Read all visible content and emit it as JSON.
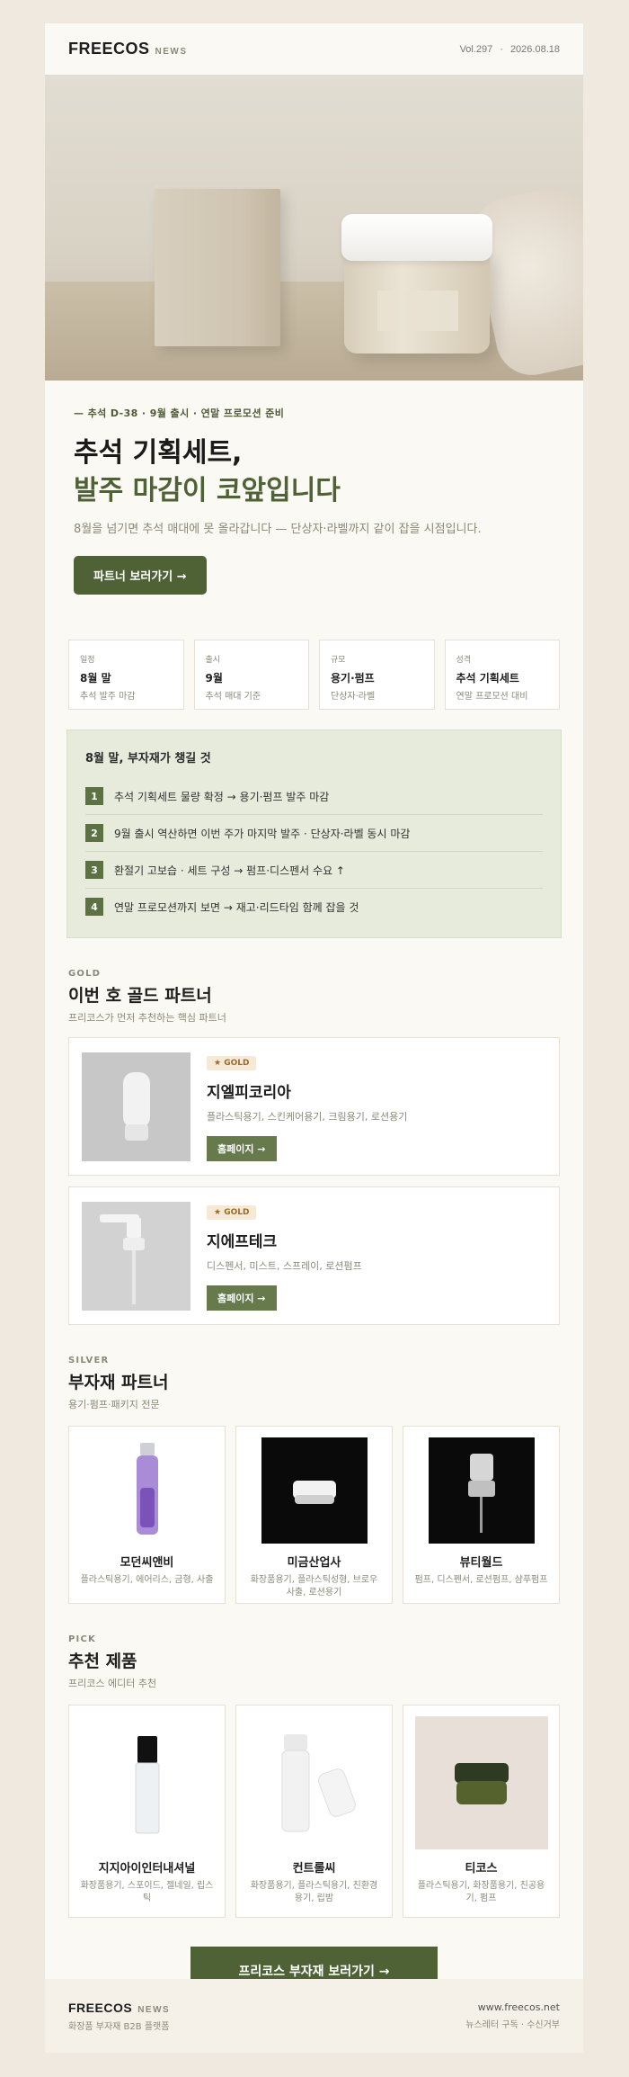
{
  "header": {
    "brand": "FREECOS",
    "brand_sub": "NEWS",
    "volume": "Vol.297",
    "dot": "·",
    "date": "2026.08.18"
  },
  "intro": {
    "tagline": "— 추석 D-38 · 9월 출시 · 연말 프로모션 준비",
    "title_line1": "추석 기획세트,",
    "title_line2": "발주 마감이 코앞입니다",
    "desc": "8월을 넘기면 추석 매대에 못 올라갑니다 — 단상자·라벨까지 같이 잡을 시점입니다.",
    "cta": "파트너 보러가기 →"
  },
  "stats": [
    {
      "key": "일정",
      "value": "8월 말",
      "sub": "추석 발주 마감"
    },
    {
      "key": "출시",
      "value": "9월",
      "sub": "추석 매대 기준"
    },
    {
      "key": "규모",
      "value": "용기·펌프",
      "sub": "단상자·라벨"
    },
    {
      "key": "성격",
      "value": "추석 기획세트",
      "sub": "연말 프로모션 대비"
    }
  ],
  "checklist": {
    "title": "8월 말, 부자재가 챙길 것",
    "items": [
      {
        "num": "1",
        "text": "추석 기획세트 물량 확정 → 용기·펌프 발주 마감"
      },
      {
        "num": "2",
        "text": "9월 출시 역산하면 이번 주가 마지막 발주 · 단상자·라벨 동시 마감"
      },
      {
        "num": "3",
        "text": "환절기 고보습 · 세트 구성 → 펌프·디스펜서 수요 ↑"
      },
      {
        "num": "4",
        "text": "연말 프로모션까지 보면 → 재고·리드타임 함께 잡을 것"
      }
    ]
  },
  "gold": {
    "label": "GOLD",
    "title": "이번 호 골드 파트너",
    "sub": "프리코스가 먼저 추천하는 핵심 파트너",
    "cards": [
      {
        "badge": "★ GOLD",
        "name": "지엘피코리아",
        "cats": "플라스틱용기, 스킨케어용기, 크림용기, 로션용기",
        "button": "홈페이지 →"
      },
      {
        "badge": "★ GOLD",
        "name": "지에프테크",
        "cats": "디스펜서, 미스트, 스프레이, 로션펌프",
        "button": "홈페이지 →"
      }
    ]
  },
  "silver": {
    "label": "SILVER",
    "title": "부자재 파트너",
    "sub": "용기·펌프·패키지 전문",
    "items": [
      {
        "name": "모던씨앤비",
        "cats": "플라스틱용기, 에어리스, 금형, 사출"
      },
      {
        "name": "미금산업사",
        "cats": "화장품용기, 플라스틱성형, 브로우사출, 로션용기"
      },
      {
        "name": "뷰티월드",
        "cats": "펌프, 디스펜서, 로션펌프, 샴푸펌프"
      }
    ]
  },
  "pick": {
    "label": "PICK",
    "title": "추천 제품",
    "sub": "프리코스 에디터 추천",
    "items": [
      {
        "name": "지지아이인터내셔널",
        "cats": "화장품용기, 스포이드, 젤네일, 립스틱"
      },
      {
        "name": "컨트롤씨",
        "cats": "화장품용기, 플라스틱용기, 친환경용기, 립밤"
      },
      {
        "name": "티코스",
        "cats": "플라스틱용기, 화장품용기, 친공용기, 펌프"
      }
    ]
  },
  "cta": "프리코스 부자재 보러가기 →",
  "footer": {
    "brand": "FREECOS",
    "brand_sub": "NEWS",
    "sub": "화장품 부자재 B2B 플랫폼",
    "site": "www.freecos.net",
    "links": "뉴스레터 구독 · 수신거부"
  },
  "colors": {
    "accent": "#4f6236",
    "button_small": "#667a4c",
    "check_bg": "#e6ebdc",
    "badge_bg": "#f6ead7",
    "page_bg": "#efe9df"
  }
}
